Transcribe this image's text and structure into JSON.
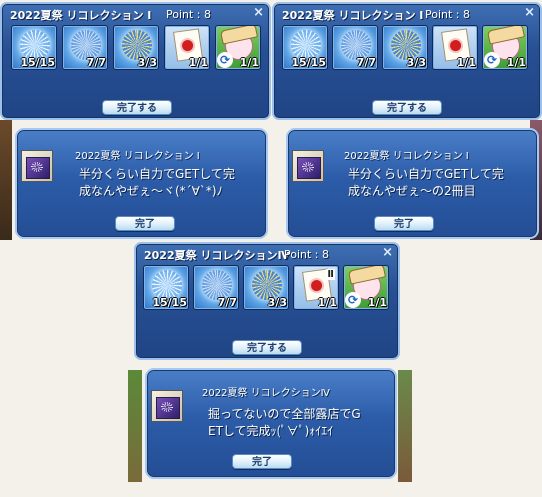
{
  "windows": [
    {
      "title": "2022夏祭 リコレクション Ⅰ",
      "point": "Point : 8",
      "counts": [
        "15/15",
        "7/7",
        "3/3",
        "1/1",
        "1/1"
      ],
      "button": "完了する",
      "dialog": {
        "title": "2022夏祭 リコレクション Ⅰ",
        "line1": "半分くらい自力でGETして完",
        "line2": "成なんやぜぇ～ヾ(*´∀`*)ﾉ",
        "button": "完了"
      }
    },
    {
      "title": "2022夏祭 リコレクション Ⅰ",
      "point": "Point : 8",
      "counts": [
        "15/15",
        "7/7",
        "3/3",
        "1/1",
        "1/1"
      ],
      "button": "完了する",
      "dialog": {
        "title": "2022夏祭 リコレクション Ⅰ",
        "line1": "半分くらい自力でGETして完",
        "line2": "成なんやぜぇ～の2冊目",
        "button": "完了"
      }
    },
    {
      "title": "2022夏祭 リコレクションⅣ",
      "point": "Point : 8",
      "counts": [
        "15/15",
        "7/7",
        "3/3",
        "1/1",
        "1/1"
      ],
      "button": "完了する",
      "badge": "Ⅱ",
      "dialog": {
        "title": "2022夏祭 リコレクションⅣ",
        "line1": "掘ってないので全部露店でG",
        "line2": "ETして完成ｯ(ﾟ∀ﾟ)ｫｲｴｲ",
        "button": "完了"
      }
    }
  ],
  "icons": {
    "close": "×",
    "cycle": "⟳"
  },
  "colors": {
    "panel": "#284f93",
    "border": "#9cc0ec",
    "count_text": "#ffffff"
  }
}
